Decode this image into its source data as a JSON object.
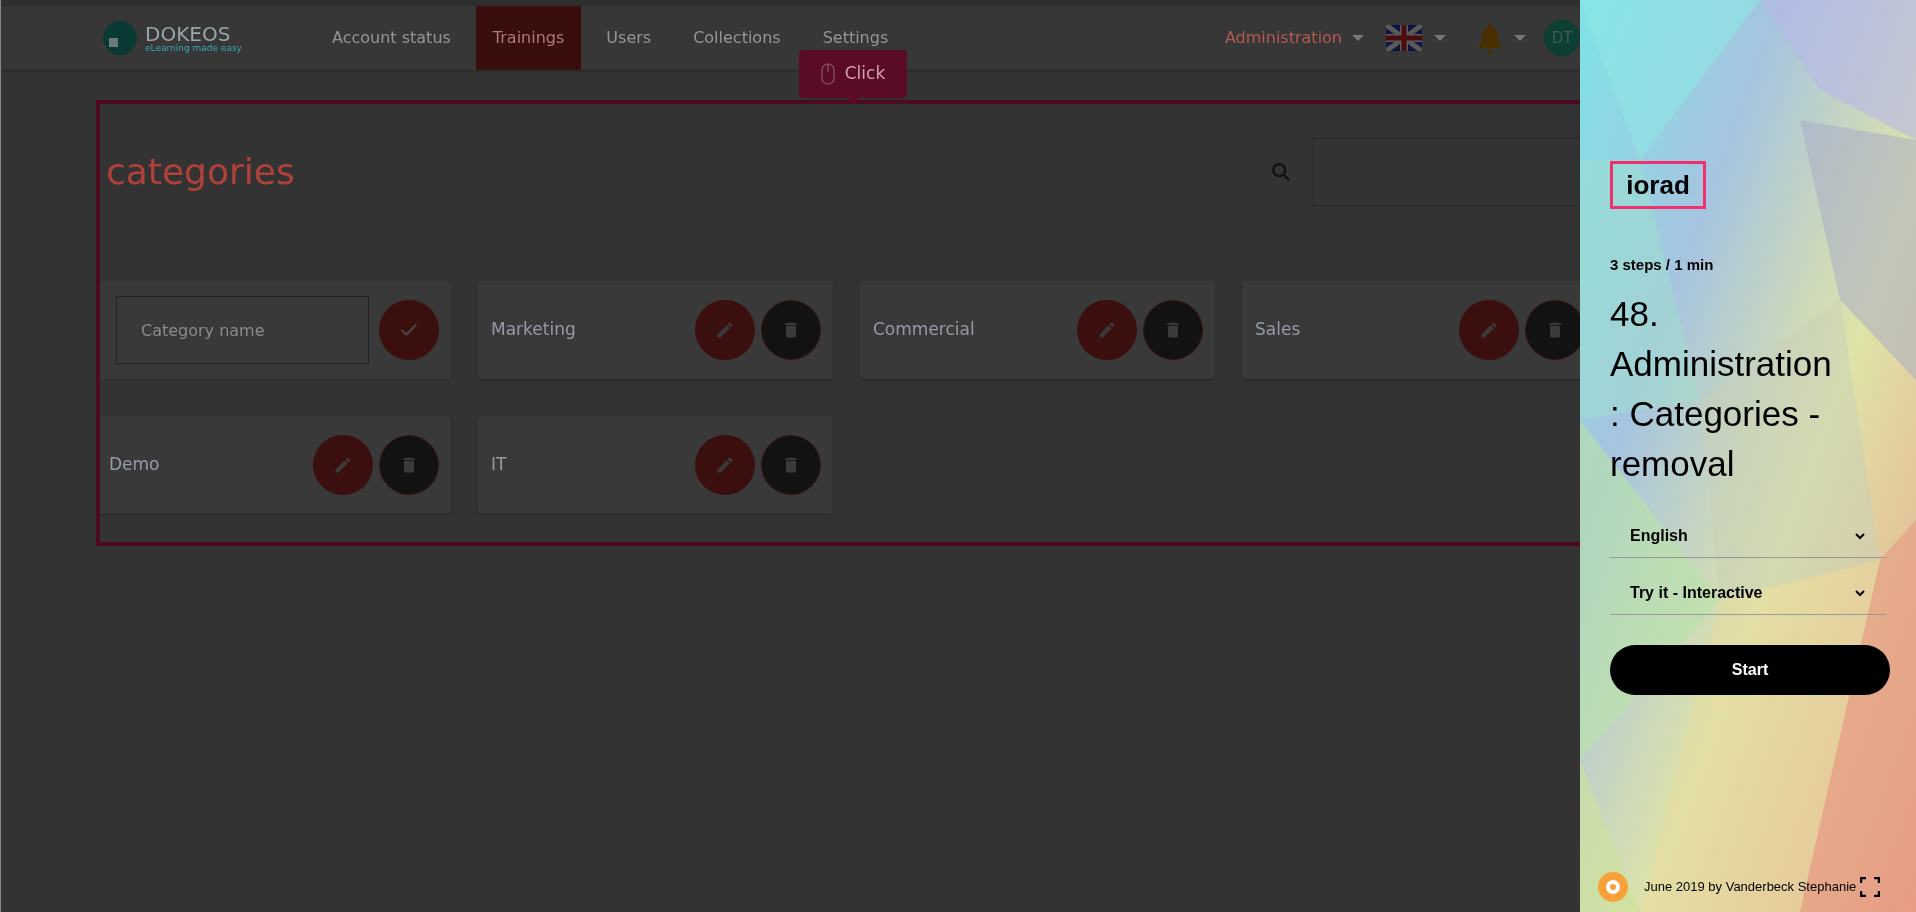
{
  "nav": {
    "logo": {
      "name": "DOKEOS",
      "tagline": "eLearning made easy"
    },
    "items": [
      {
        "label": "Account status",
        "selected": false
      },
      {
        "label": "Trainings",
        "selected": true
      },
      {
        "label": "Users",
        "selected": false
      },
      {
        "label": "Collections",
        "selected": false
      },
      {
        "label": "Settings",
        "selected": false
      }
    ],
    "admin_menu": "Administration",
    "avatar": "DT"
  },
  "tooltip": {
    "label": "Click"
  },
  "page": {
    "title": "categories",
    "new_category": {
      "placeholder": "Category name"
    },
    "categories": [
      {
        "name": "Marketing"
      },
      {
        "name": "Commercial"
      },
      {
        "name": "Sales"
      },
      {
        "name": "Demo"
      },
      {
        "name": "IT"
      }
    ]
  },
  "panel": {
    "brand": "iorad",
    "meta": "3 steps / 1 min",
    "title": "48. Administration : Categories - removal",
    "selects": [
      {
        "value": "English"
      },
      {
        "value": "Try it - Interactive"
      }
    ],
    "start": "Start",
    "footer": "June 2019 by Vanderbeck Stephanie"
  }
}
